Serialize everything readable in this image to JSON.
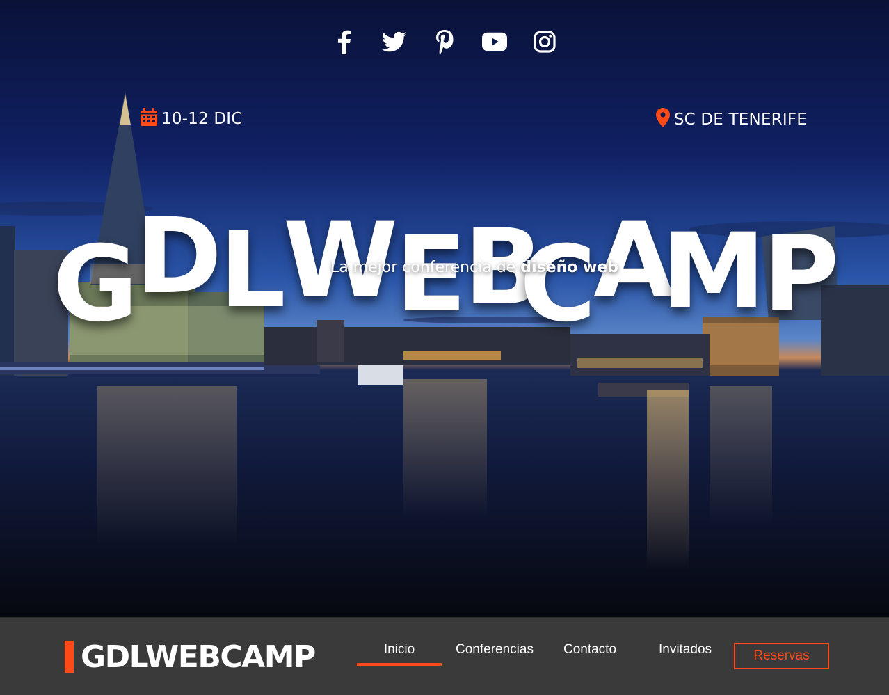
{
  "hero": {
    "social": [
      {
        "name": "facebook-icon"
      },
      {
        "name": "twitter-icon"
      },
      {
        "name": "pinterest-icon"
      },
      {
        "name": "youtube-icon"
      },
      {
        "name": "instagram-icon"
      }
    ],
    "date": "10-12 DIC",
    "location": "SC DE TENERIFE",
    "title_letters": [
      "G",
      "D",
      "L",
      "W",
      "E",
      "B",
      "C",
      "A",
      "M",
      "P"
    ],
    "tagline_prefix": "La mejor conferencia de",
    "tagline_bold": "diseño web"
  },
  "navbar": {
    "logo": "GDLWEBCAMP",
    "items": [
      {
        "label": "Inicio",
        "active": true
      },
      {
        "label": "Conferencias",
        "active": false
      },
      {
        "label": "Contacto",
        "active": false
      },
      {
        "label": "Invitados",
        "active": false
      }
    ],
    "cta": "Reservas"
  },
  "colors": {
    "accent": "#fe4918",
    "bar": "#3a3a3a",
    "sky_top": "#0a1238",
    "sky_horizon": "#3b6fc0"
  }
}
